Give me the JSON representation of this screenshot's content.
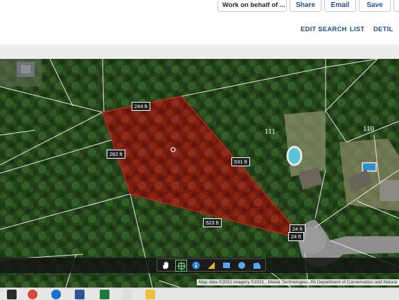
{
  "toolbar": {
    "select_value": "Work on behalf of ...",
    "share_label": "Share",
    "email_label": "Email",
    "save_label": "Save"
  },
  "nav": {
    "edit_search": "EDIT SEARCH",
    "list": "LIST",
    "detail": "DETIL"
  },
  "map": {
    "parcel_numbers": [
      "111",
      "110"
    ],
    "dimensions": [
      "244 ft",
      "262 ft",
      "531 ft",
      "523 ft",
      "24 ft",
      "24 ft"
    ],
    "attribution": "Map data ©2021 Imagery ©2021 , Maxar Technologies, PA Department of Conservation and Natura",
    "highlight_color": "#8b1a10",
    "tools": [
      "hand-icon",
      "crosshair-icon",
      "info-icon",
      "ruler-icon",
      "rectangle-icon",
      "circle-icon",
      "polygon-icon"
    ]
  },
  "taskbar": {
    "icons": [
      "file-explorer-icon",
      "chrome-icon",
      "edge-icon",
      "word-icon",
      "excel-icon",
      "folder-icon"
    ]
  }
}
